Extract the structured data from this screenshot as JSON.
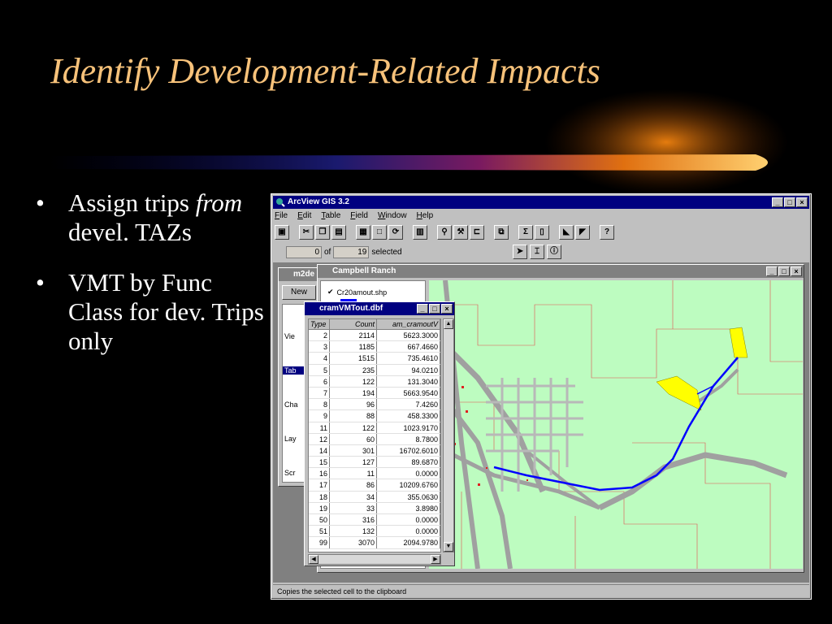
{
  "slide": {
    "title": "Identify Development-Related Impacts",
    "bullets": [
      {
        "pre": "Assign trips ",
        "em": "from",
        "post": " devel. TAZs"
      },
      {
        "pre": "VMT by Func Class for dev. Trips only",
        "em": "",
        "post": ""
      }
    ],
    "bullet_glyph": "•"
  },
  "app": {
    "title": "ArcView GIS 3.2",
    "menu": [
      "File",
      "Edit",
      "Table",
      "Field",
      "Window",
      "Help"
    ],
    "selection": {
      "count": "0",
      "of_label": "of",
      "total": "19",
      "selected_label": "selected"
    },
    "status": "Copies the selected cell to the clipboard",
    "window_buttons": [
      "_",
      "□",
      "×"
    ]
  },
  "project": {
    "title": "m2de",
    "new_label": "New",
    "items": [
      "Vie",
      "Tab",
      "Cha",
      "Lay",
      "Scr"
    ]
  },
  "view": {
    "title": "Campbell Ranch",
    "theme_name": "Cr20amout.shp",
    "theme_color": "#0000ff"
  },
  "table": {
    "title": "cramVMTout.dbf",
    "headers": [
      "Type",
      "Count",
      "am_cramoutV"
    ],
    "rows": [
      [
        "2",
        "2114",
        "5623.3000"
      ],
      [
        "3",
        "1185",
        "667.4660"
      ],
      [
        "4",
        "1515",
        "735.4610"
      ],
      [
        "5",
        "235",
        "94.0210"
      ],
      [
        "6",
        "122",
        "131.3040"
      ],
      [
        "7",
        "194",
        "5663.9540"
      ],
      [
        "8",
        "96",
        "7.4260"
      ],
      [
        "9",
        "88",
        "458.3300"
      ],
      [
        "11",
        "122",
        "1023.9170"
      ],
      [
        "12",
        "60",
        "8.7800"
      ],
      [
        "14",
        "301",
        "16702.6010"
      ],
      [
        "15",
        "127",
        "89.6870"
      ],
      [
        "16",
        "11",
        "0.0000"
      ],
      [
        "17",
        "86",
        "10209.6760"
      ],
      [
        "18",
        "34",
        "355.0630"
      ],
      [
        "19",
        "33",
        "3.8980"
      ],
      [
        "50",
        "316",
        "0.0000"
      ],
      [
        "51",
        "132",
        "0.0000"
      ],
      [
        "99",
        "3070",
        "2094.9780"
      ]
    ]
  },
  "colors": {
    "title": "#f7c27a",
    "map_bg": "#bdfcc0",
    "road": "#a0a0a0",
    "route": "#0000ff",
    "highlight": "#ffff00"
  }
}
